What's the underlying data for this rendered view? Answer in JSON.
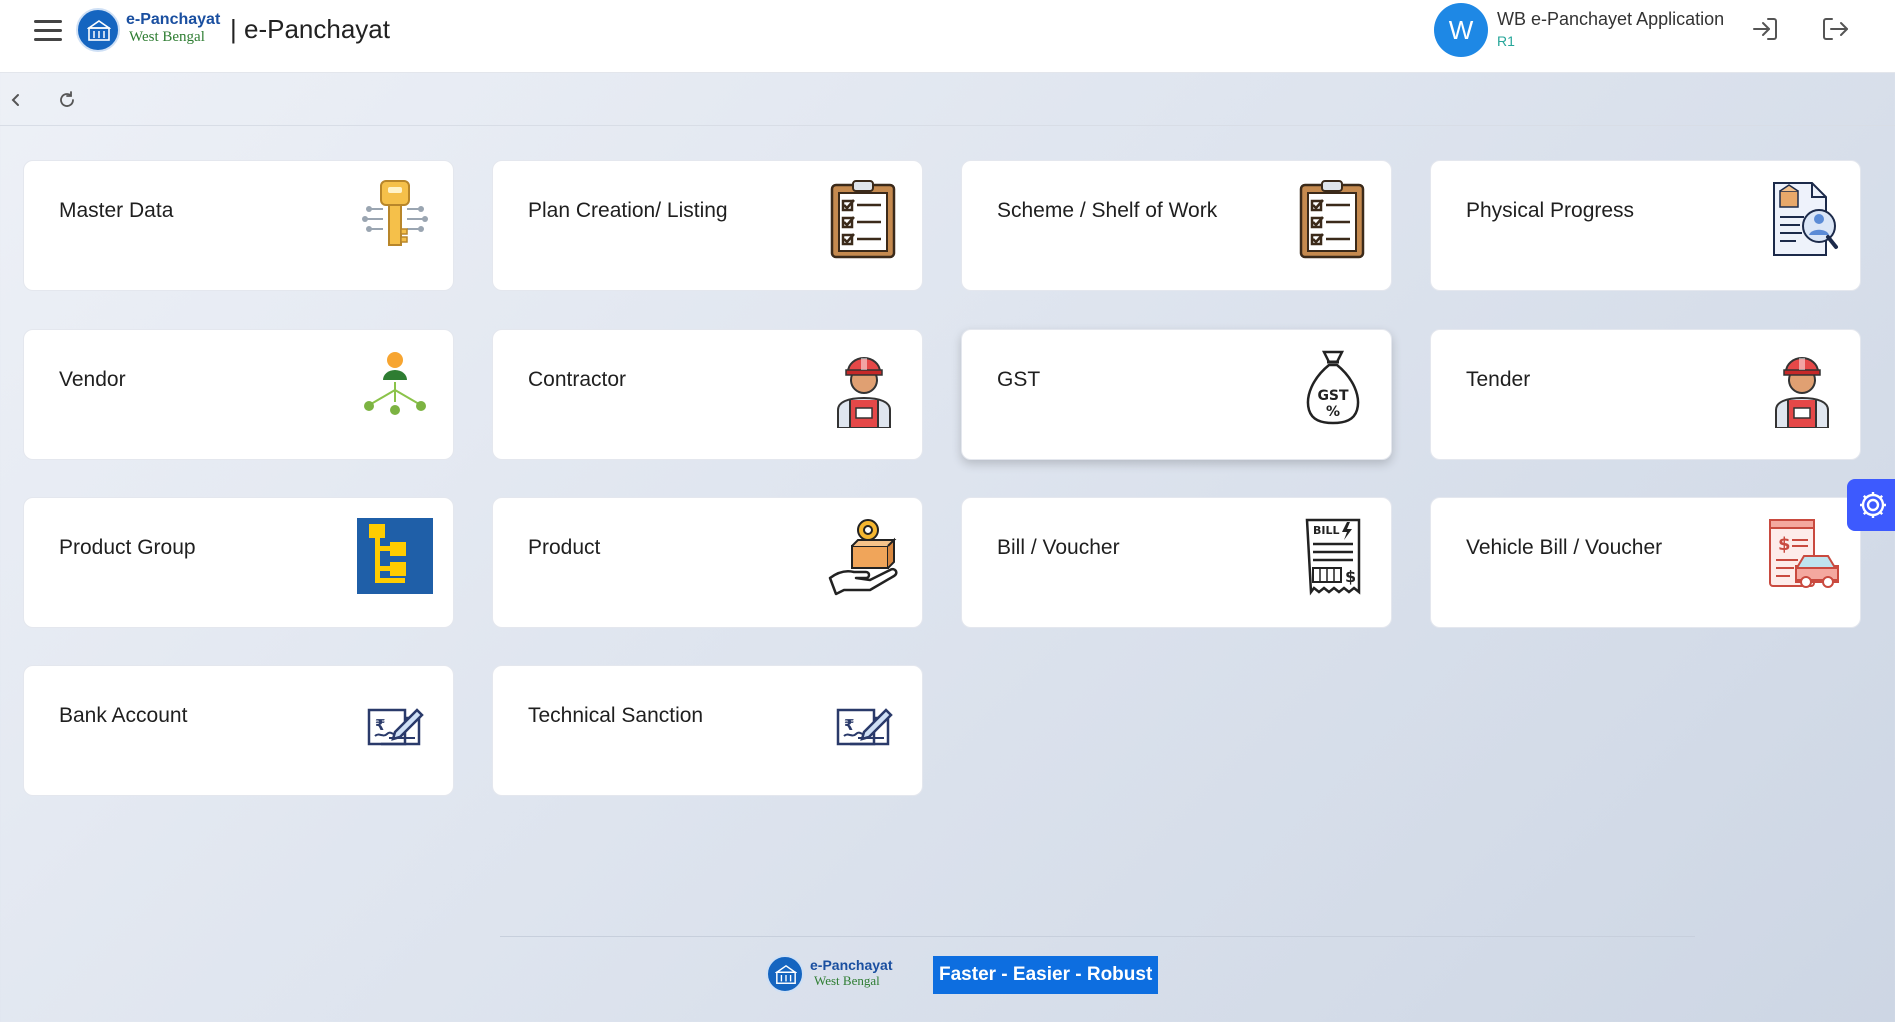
{
  "header": {
    "logo": {
      "line1": "e-Panchayat",
      "line2": "West Bengal"
    },
    "title": "| e-Panchayat",
    "user": {
      "avatar_letter": "W",
      "name": "WB e-Panchayet Application",
      "role": "R1"
    }
  },
  "cards": [
    {
      "label": "Master Data",
      "icon": "key-network-icon"
    },
    {
      "label": "Plan Creation/ Listing",
      "icon": "clipboard-checklist-icon"
    },
    {
      "label": "Scheme / Shelf of Work",
      "icon": "clipboard-checklist-icon"
    },
    {
      "label": "Physical Progress",
      "icon": "document-inspection-icon"
    },
    {
      "label": "Vendor",
      "icon": "hierarchy-person-icon"
    },
    {
      "label": "Contractor",
      "icon": "worker-icon"
    },
    {
      "label": "GST",
      "icon": "gst-money-bag-icon"
    },
    {
      "label": "Tender",
      "icon": "worker-icon"
    },
    {
      "label": "Product Group",
      "icon": "product-group-tree-icon"
    },
    {
      "label": "Product",
      "icon": "product-hand-box-icon"
    },
    {
      "label": "Bill / Voucher",
      "icon": "bill-receipt-icon"
    },
    {
      "label": "Vehicle Bill / Voucher",
      "icon": "vehicle-bill-icon"
    },
    {
      "label": "Bank Account",
      "icon": "rupee-cheque-icon"
    },
    {
      "label": "Technical Sanction",
      "icon": "rupee-cheque-icon"
    }
  ],
  "footer": {
    "logo": {
      "line1": "e-Panchayat",
      "line2": "West Bengal"
    },
    "tagline": "Faster - Easier - Robust"
  },
  "colors": {
    "accent": "#1e88e5",
    "tagline_bg": "#0d6ee0",
    "settings_fab": "#3d5afe"
  }
}
